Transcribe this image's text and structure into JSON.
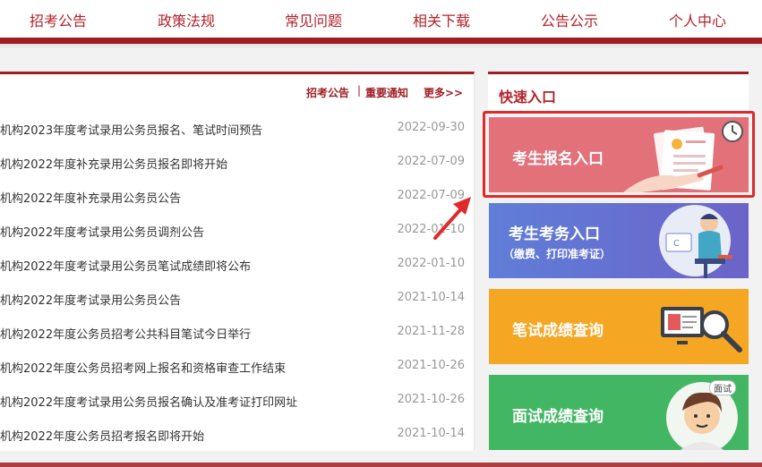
{
  "nav": {
    "items": [
      "招考公告",
      "政策法规",
      "常见问题",
      "相关下载",
      "公告公示",
      "个人中心"
    ]
  },
  "news_panel": {
    "links": [
      "招考公告",
      "重要通知",
      "更多>>"
    ],
    "separator": "|",
    "items": [
      {
        "title": "机构2023年度考试录用公务员报名、笔试时间预告",
        "date": "2022-09-30"
      },
      {
        "title": "机构2022年度补充录用公务员报名即将开始",
        "date": "2022-07-09"
      },
      {
        "title": "机构2022年度补充录用公务员公告",
        "date": "2022-07-09"
      },
      {
        "title": "机构2022年度考试录用公务员调剂公告",
        "date": "2022-01-10"
      },
      {
        "title": "机构2022年度考试录用公务员笔试成绩即将公布",
        "date": "2022-01-10"
      },
      {
        "title": "机构2022年度考试录用公务员公告",
        "date": "2021-10-14"
      },
      {
        "title": "机构2022年度公务员招考公共科目笔试今日举行",
        "date": "2021-11-28"
      },
      {
        "title": "机构2022年度公务员招考网上报名和资格审查工作结束",
        "date": "2021-10-26"
      },
      {
        "title": "机构2022年度考试录用公务员报名确认及准考证打印网址",
        "date": "2021-10-26"
      },
      {
        "title": "机构2022年度公务员招考报名即将开始",
        "date": "2021-10-14"
      }
    ]
  },
  "quick_entry": {
    "title": "快速入口",
    "cards": {
      "register": {
        "label": "考生报名入口"
      },
      "exam": {
        "label": "考生考务入口",
        "sub": "（缴费、打印准考证）"
      },
      "written": {
        "label": "笔试成绩查询"
      },
      "interview": {
        "label": "面试成绩查询",
        "badge": "面试"
      }
    }
  },
  "colors": {
    "brand_red": "#a11d22",
    "highlight_red": "#e02a2a",
    "card_register": "#e2717a",
    "card_exam": "#6272d2",
    "card_written": "#f5a623",
    "card_interview": "#43b664"
  }
}
